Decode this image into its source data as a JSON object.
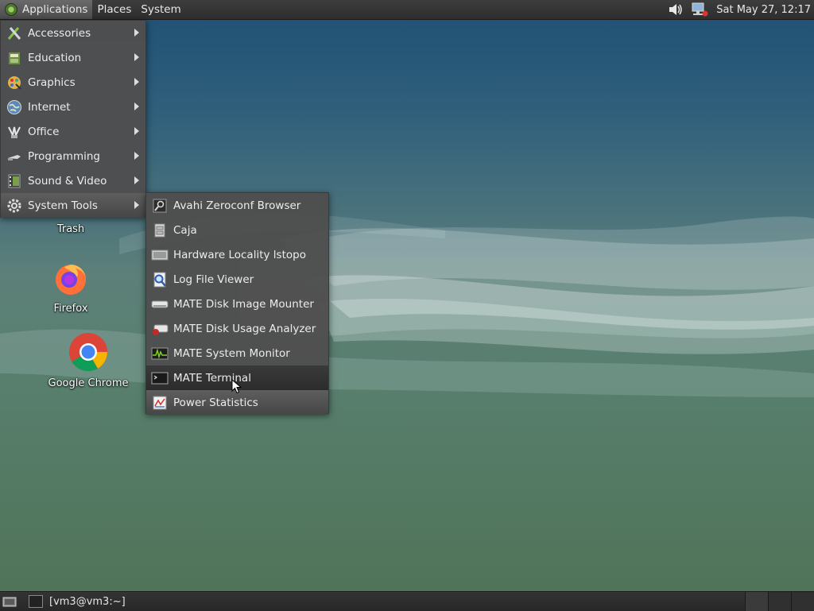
{
  "top_panel": {
    "menus": [
      "Applications",
      "Places",
      "System"
    ],
    "clock": "Sat May 27, 12:17",
    "tray_icons": [
      "volume-icon",
      "network-icon"
    ]
  },
  "applications_menu": {
    "items": [
      {
        "label": "Accessories",
        "icon": "accessories-icon"
      },
      {
        "label": "Education",
        "icon": "education-icon"
      },
      {
        "label": "Graphics",
        "icon": "graphics-icon"
      },
      {
        "label": "Internet",
        "icon": "internet-icon"
      },
      {
        "label": "Office",
        "icon": "office-icon"
      },
      {
        "label": "Programming",
        "icon": "programming-icon"
      },
      {
        "label": "Sound & Video",
        "icon": "sound-video-icon"
      },
      {
        "label": "System Tools",
        "icon": "system-tools-icon",
        "active": true
      }
    ]
  },
  "system_tools_submenu": {
    "items": [
      {
        "label": "Avahi Zeroconf Browser",
        "icon": "avahi-icon"
      },
      {
        "label": "Caja",
        "icon": "file-cabinet-icon"
      },
      {
        "label": "Hardware Locality lstopo",
        "icon": "hardware-icon"
      },
      {
        "label": "Log File Viewer",
        "icon": "log-viewer-icon"
      },
      {
        "label": "MATE Disk Image Mounter",
        "icon": "disk-mounter-icon"
      },
      {
        "label": "MATE Disk Usage Analyzer",
        "icon": "disk-usage-icon"
      },
      {
        "label": "MATE System Monitor",
        "icon": "system-monitor-icon"
      },
      {
        "label": "MATE Terminal",
        "icon": "terminal-icon",
        "hovered": true
      },
      {
        "label": "Power Statistics",
        "icon": "power-statistics-icon"
      }
    ]
  },
  "desktop_icons": [
    {
      "label": "Trash",
      "icon": "trash-icon"
    },
    {
      "label": "Firefox",
      "icon": "firefox-icon"
    },
    {
      "label": "Google Chrome",
      "icon": "chrome-icon"
    }
  ],
  "bottom_panel": {
    "task": "[vm3@vm3:~]"
  }
}
